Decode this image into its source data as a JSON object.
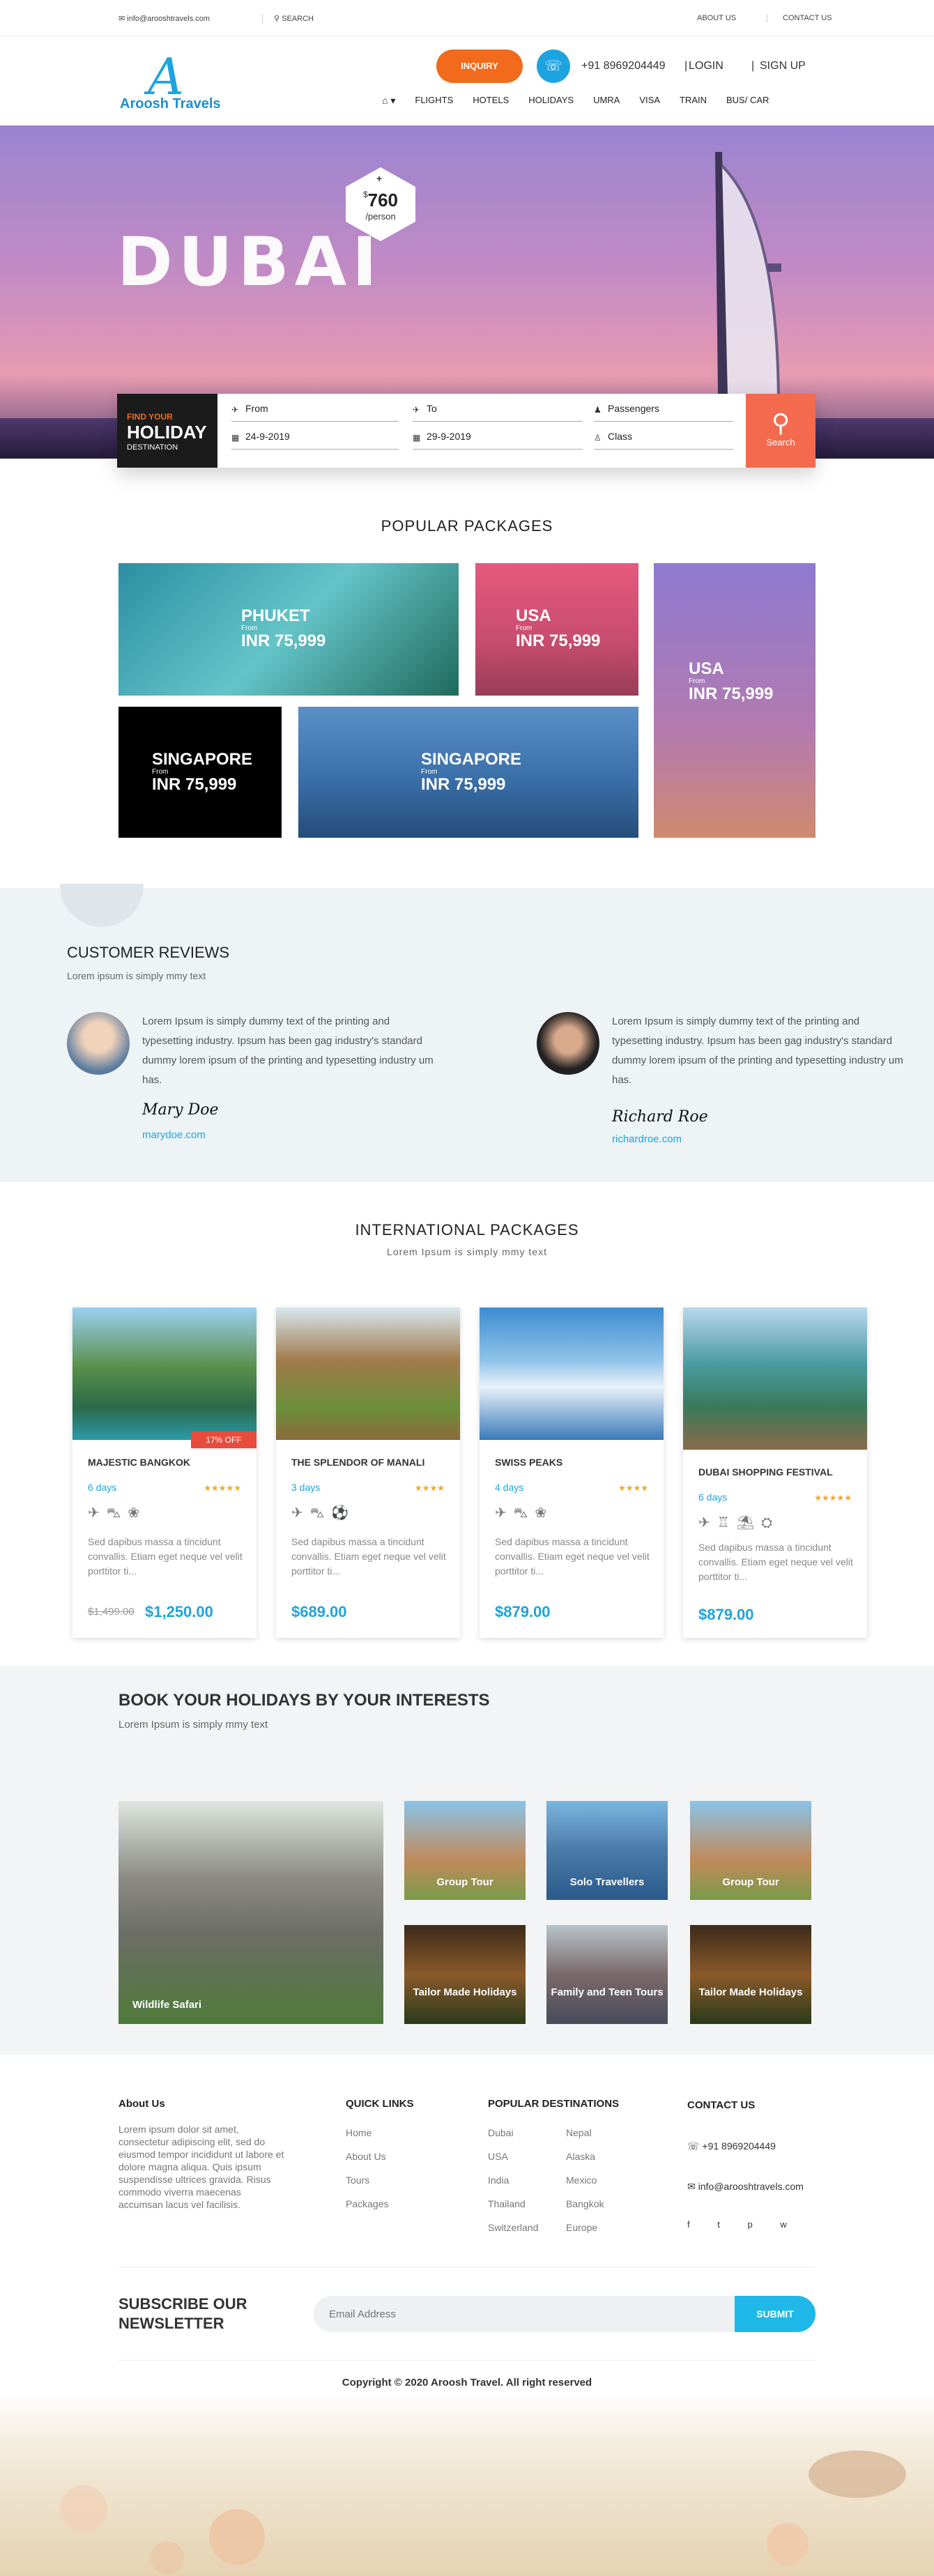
{
  "topbar": {
    "email": "info@arooshtravels.com",
    "search": "SEARCH",
    "about": "ABOUT US",
    "contact": "CONTACT US"
  },
  "header": {
    "logo_letter": "A",
    "logo_text": "Aroosh Travels",
    "inquiry": "INQUIRY",
    "phone": "+91 8969204449",
    "login": "LOGIN",
    "signup": "SIGN UP",
    "sep": "|"
  },
  "nav": [
    "FLIGHTS",
    "HOTELS",
    "HOLIDAYS",
    "UMRA",
    "VISA",
    "TRAIN",
    "BUS/ CAR"
  ],
  "hero": {
    "title": "DUBAI",
    "plus": "+",
    "currency": "$",
    "price": "760",
    "per": "/person"
  },
  "search": {
    "find": "FIND YOUR",
    "holiday": "HOLIDAY",
    "destination": "DESTINATION",
    "from": "From",
    "to": "To",
    "passengers": "Passengers",
    "date_from": "24-9-2019",
    "date_to": "29-9-2019",
    "class": "Class",
    "button": "Search"
  },
  "popular": {
    "title": "POPULAR PACKAGES",
    "from_label": "From",
    "tiles": [
      {
        "name": "PHUKET",
        "price": "INR 75,999"
      },
      {
        "name": "USA",
        "price": "INR 75,999"
      },
      {
        "name": "USA",
        "price": "INR 75,999"
      },
      {
        "name": "SINGAPORE",
        "price": "INR 75,999"
      },
      {
        "name": "SINGAPORE",
        "price": "INR 75,999"
      }
    ]
  },
  "reviews": {
    "title": "CUSTOMER REVIEWS",
    "subtitle": "Lorem ipsum is simply mmy text",
    "items": [
      {
        "text": "Lorem Ipsum is simply dummy text of the printing and typesetting industry. Ipsum has been gag industry's standard dummy lorem ipsum of the printing and typesetting industry um has.",
        "signature": "Mary Doe",
        "link": "marydoe.com"
      },
      {
        "text": "Lorem Ipsum is simply dummy text of the printing and typesetting industry. Ipsum has been gag industry's standard dummy lorem ipsum of the printing and typesetting industry um has.",
        "signature": "Richard Roe",
        "link": "richardroe.com"
      }
    ]
  },
  "international": {
    "title": "INTERNATIONAL PACKAGES",
    "subtitle": "Lorem Ipsum is simply mmy text",
    "cards": [
      {
        "title": "MAJESTIC BANGKOK",
        "days": "6 days",
        "stars": "★★★★★",
        "desc": "Sed dapibus massa a tincidunt convallis. Etiam eget neque vel velit porttitor ti...",
        "old": "$1,499.00",
        "price": "$1,250.00",
        "badge": "17% OFF"
      },
      {
        "title": "THE SPLENDOR OF MANALI",
        "days": "3 days",
        "stars": "★★★★",
        "desc": "Sed dapibus massa a tincidunt convallis. Etiam eget neque vel velit porttitor ti...",
        "price": "$689.00"
      },
      {
        "title": "SWISS PEAKS",
        "days": "4 days",
        "stars": "★★★★",
        "desc": "Sed dapibus massa a tincidunt convallis. Etiam eget neque vel velit porttitor ti...",
        "price": "$879.00"
      },
      {
        "title": "DUBAI SHOPPING FESTIVAL",
        "days": "6 days",
        "stars": "★★★★★",
        "desc": "Sed dapibus massa a tincidunt convallis. Etiam eget neque vel velit porttitor ti...",
        "price": "$879.00"
      }
    ]
  },
  "interests": {
    "title": "BOOK YOUR HOLIDAYS BY YOUR INTERESTS",
    "subtitle": "Lorem Ipsum is simply mmy text",
    "tiles": [
      "Wildlife Safari",
      "Group Tour",
      "Solo Travellers",
      "Group Tour",
      "Tailor Made Holidays",
      "Family and Teen Tours",
      "Tailor Made Holidays"
    ]
  },
  "footer": {
    "about_title": "About Us",
    "about_text": "Lorem ipsum dolor sit amet, consectetur adipiscing elit, sed do eiusmod tempor incididunt ut labore et dolore magna aliqua. Quis ipsum suspendisse ultrices gravida. Risus commodo viverra maecenas accumsan lacus vel facilisis.",
    "quick_title": "QUICK LINKS",
    "quick": [
      "Home",
      "About Us",
      "Tours",
      "Packages"
    ],
    "dest_title": "POPULAR DESTINATIONS",
    "dest_col1": [
      "Dubai",
      "USA",
      "India",
      "Thailand",
      "Switzerland"
    ],
    "dest_col2": [
      "Nepal",
      "Alaska",
      "Mexico",
      "Bangkok",
      "Europe"
    ],
    "contact_title": "CONTACT US",
    "phone": "+91 8969204449",
    "email": "info@arooshtravels.com",
    "social": "f t p w"
  },
  "newsletter": {
    "title": "SUBSCRIBE OUR NEWSLETTER",
    "placeholder": "Email Address",
    "submit": "SUBMIT"
  },
  "copyright": "Copyright © 2020 Aroosh Travel. All right reserved"
}
